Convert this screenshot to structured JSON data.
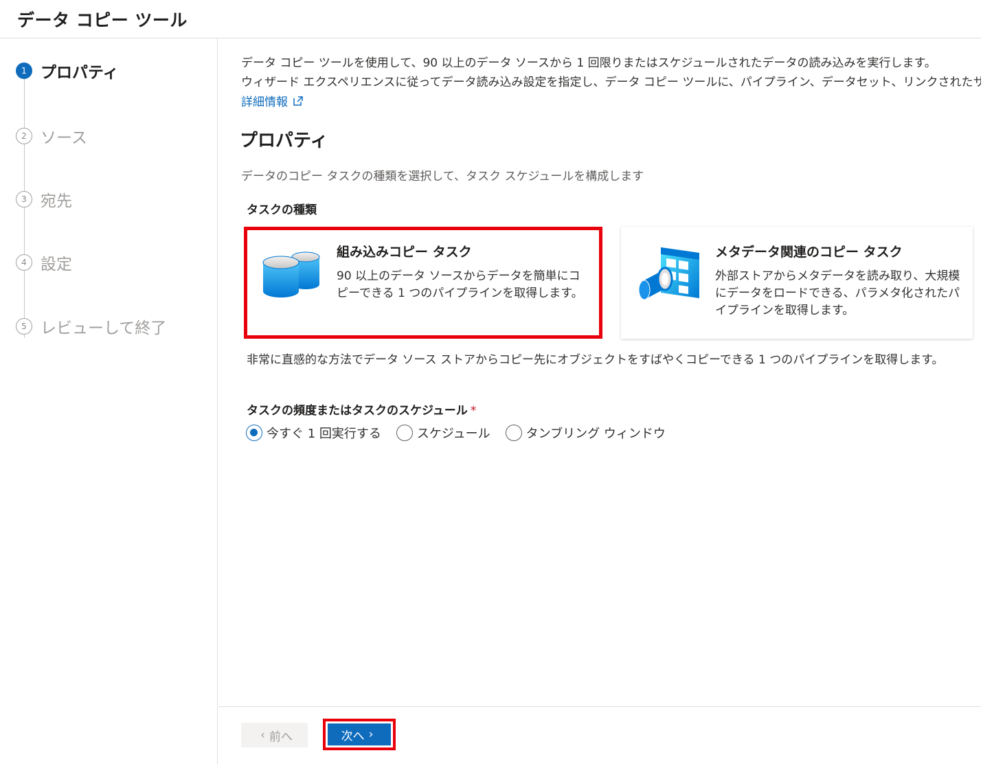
{
  "header": {
    "title": "データ コピー ツール"
  },
  "wizard": {
    "steps": [
      {
        "num": "1",
        "label": "プロパティ"
      },
      {
        "num": "2",
        "label": "ソース"
      },
      {
        "num": "3",
        "label": "宛先"
      },
      {
        "num": "4",
        "label": "設定"
      },
      {
        "num": "5",
        "label": "レビューして終了"
      }
    ],
    "active_step": 1
  },
  "main": {
    "intro_line1": "データ コピー ツールを使用して、90 以上のデータ ソースから 1 回限りまたはスケジュールされたデータの読み込みを実行します。",
    "intro_line2": "ウィザード エクスペリエンスに従ってデータ読み込み設定を指定し、データ コピー ツールに、パイプライン、データセット、リンクされたサービスを作成させます。",
    "learn_more": "詳細情報",
    "section_title": "プロパティ",
    "section_desc": "データのコピー タスクの種類を選択して、タスク スケジュールを構成します",
    "task_type_label": "タスクの種類",
    "cards": [
      {
        "title": "組み込みコピー タスク",
        "desc": "90 以上のデータ ソースからデータを簡単にコピーできる 1 つのパイプラインを取得します。",
        "icon": "database-icon",
        "selected": true
      },
      {
        "title": "メタデータ関連のコピー タスク",
        "desc": "外部ストアからメタデータを読み取り、大規模にデータをロードできる、パラメタ化されたパイプラインを取得します。",
        "icon": "metadata-pipeline-icon",
        "selected": false
      }
    ],
    "task_note": "非常に直感的な方法でデータ ソース ストアからコピー先にオブジェクトをすばやくコピーできる 1 つのパイプラインを取得します。",
    "schedule_label": "タスクの頻度またはタスクのスケジュール",
    "required_mark": "*",
    "schedule_options": [
      "今すぐ 1 回実行する",
      "スケジュール",
      "タンブリング ウィンドウ"
    ],
    "schedule_selected": "今すぐ 1 回実行する"
  },
  "footer": {
    "prev_label": "前へ",
    "next_label": "次へ"
  },
  "colors": {
    "accent": "#0f6cbd",
    "highlight": "#e8000b"
  }
}
